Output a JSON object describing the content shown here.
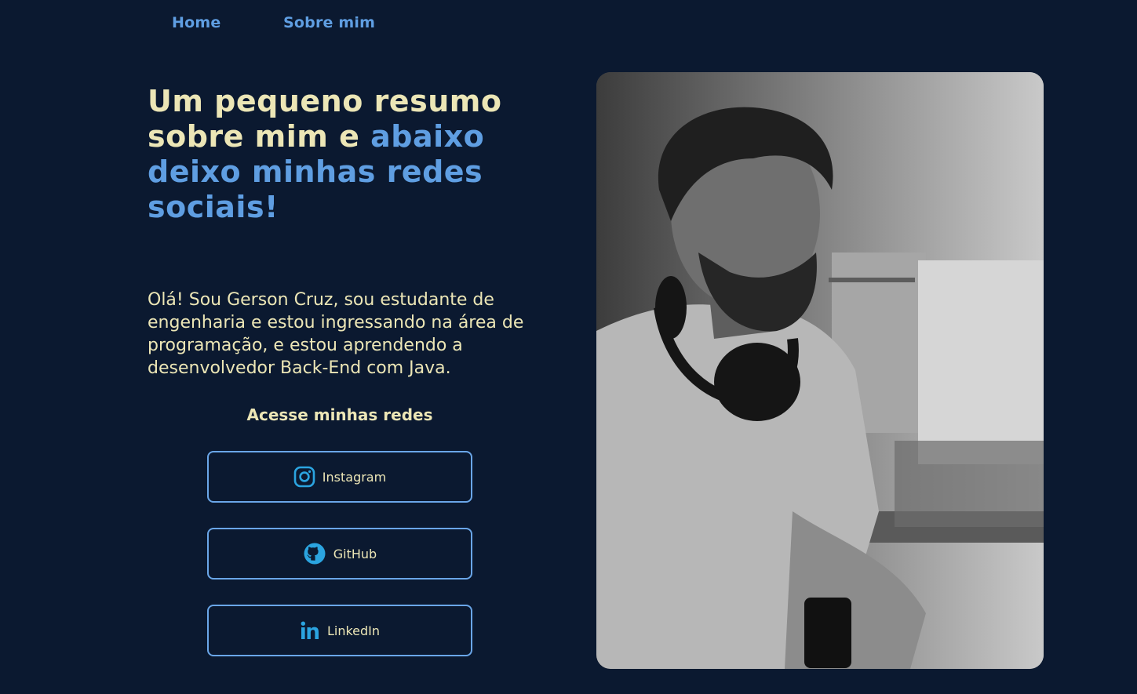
{
  "nav": {
    "home_label": "Home",
    "about_label": "Sobre mim"
  },
  "headline": {
    "part1": "Um pequeno resumo sobre mim e ",
    "part2": "abaixo deixo minhas redes sociais!"
  },
  "intro": "Olá! Sou Gerson Cruz, sou estudante de engenharia e estou ingressando na área de programação, e estou aprendendo a desenvolvedor Back-End com Java.",
  "socials": {
    "heading": "Acesse minhas redes",
    "items": [
      {
        "label": "Instagram",
        "icon": "instagram-icon"
      },
      {
        "label": "GitHub",
        "icon": "github-icon"
      },
      {
        "label": "LinkedIn",
        "icon": "linkedin-icon"
      }
    ]
  },
  "colors": {
    "background": "#0b1930",
    "accent": "#5f9ee2",
    "text": "#ece6b6",
    "icon": "#2ba4e0"
  }
}
